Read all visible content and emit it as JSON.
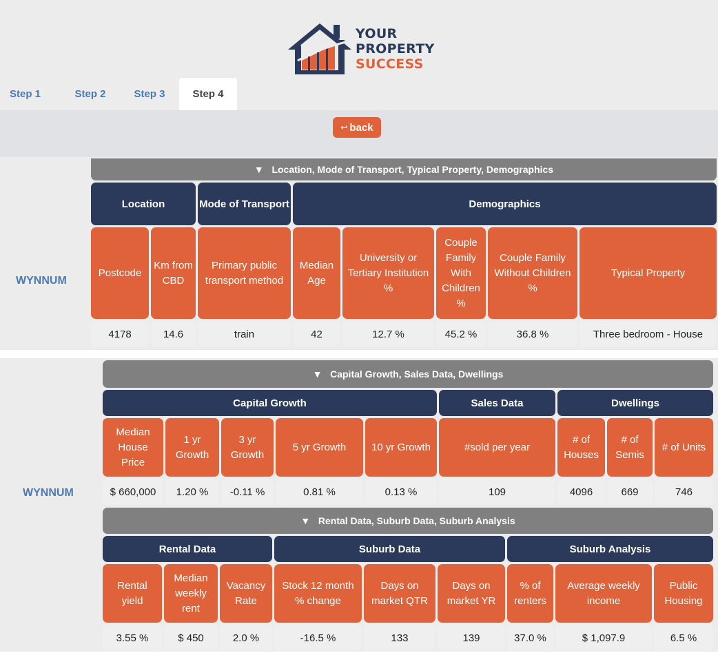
{
  "brand": {
    "line1": "YOUR",
    "line2": "PROPERTY",
    "line3": "SUCCESS",
    "colors": {
      "navy": "#2b3a5a",
      "orange": "#e0623a",
      "gray": "#808080",
      "link": "#4a7ab5"
    }
  },
  "tabs": [
    {
      "label": "Step 1",
      "active": false
    },
    {
      "label": "Step 2",
      "active": false
    },
    {
      "label": "Step 3",
      "active": false
    },
    {
      "label": "Step 4",
      "active": true
    }
  ],
  "toolbar": {
    "back_icon": "↩",
    "back_label": "back"
  },
  "suburb": "WYNNUM",
  "section1": {
    "title": "Location, Mode of Transport, Typical Property, Demographics",
    "toggle_icon": "▼",
    "groups": [
      "Location",
      "Mode of Transport",
      "Demographics"
    ],
    "columns": [
      "Postcode",
      "Km from CBD",
      "Primary public transport method",
      "Median Age",
      "University or Tertiary Institution %",
      "Couple Family With Children %",
      "Couple Family Without Children %",
      "Typical Property"
    ],
    "values": [
      "4178",
      "14.6",
      "train",
      "42",
      "12.7 %",
      "45.2 %",
      "36.8 %",
      "Three bedroom - House"
    ]
  },
  "section2": {
    "title": "Capital Growth, Sales Data, Dwellings",
    "toggle_icon": "▼",
    "groups": [
      "Capital Growth",
      "Sales Data",
      "Dwellings"
    ],
    "columns": [
      "Median House Price",
      "1 yr Growth",
      "3 yr Growth",
      "5 yr Growth",
      "10 yr Growth",
      "#sold per year",
      "# of Houses",
      "# of Semis",
      "# of Units"
    ],
    "values": [
      "$ 660,000",
      "1.20 %",
      "-0.11 %",
      "0.81 %",
      "0.13 %",
      "109",
      "4096",
      "669",
      "746"
    ]
  },
  "section3": {
    "title": "Rental Data, Suburb Data, Suburb Analysis",
    "toggle_icon": "▼",
    "groups": [
      "Rental Data",
      "Suburb Data",
      "Suburb Analysis"
    ],
    "columns": [
      "Rental yield",
      "Median weekly rent",
      "Vacancy Rate",
      "Stock 12 month % change",
      "Days on market QTR",
      "Days on market YR",
      "% of renters",
      "Average weekly income",
      "Public Housing"
    ],
    "values": [
      "3.55 %",
      "$ 450",
      "2.0 %",
      "-16.5 %",
      "133",
      "139",
      "37.0 %",
      "$ 1,097.9",
      "6.5 %"
    ]
  }
}
